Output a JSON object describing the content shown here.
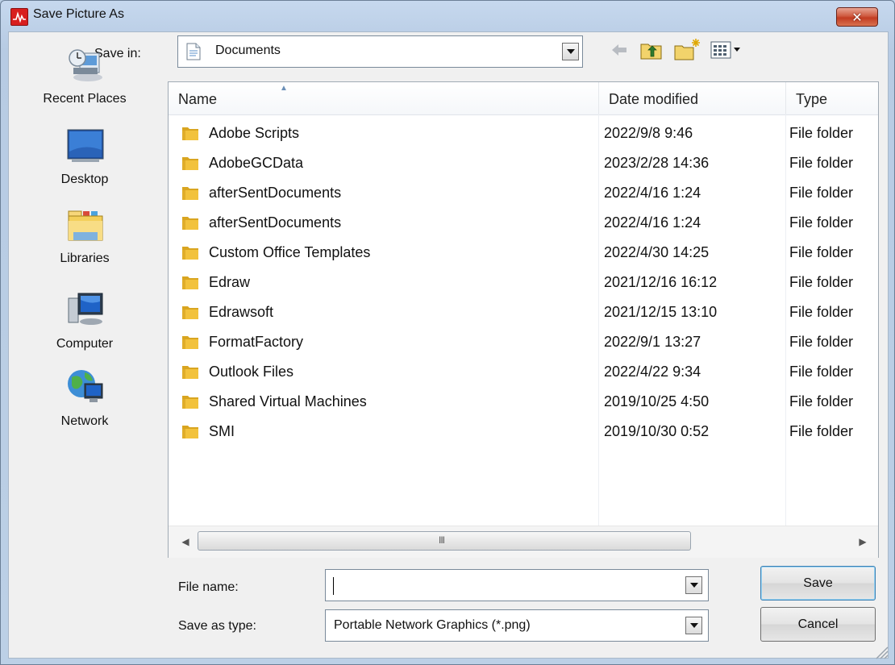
{
  "window": {
    "title": "Save Picture As",
    "close_label": "✕"
  },
  "save_in": {
    "label": "Save in:",
    "value": "Documents"
  },
  "places": [
    {
      "label": "Recent Places",
      "icon": "recent-places-icon"
    },
    {
      "label": "Desktop",
      "icon": "desktop-icon"
    },
    {
      "label": "Libraries",
      "icon": "libraries-icon"
    },
    {
      "label": "Computer",
      "icon": "computer-icon"
    },
    {
      "label": "Network",
      "icon": "network-icon"
    }
  ],
  "columns": {
    "name": "Name",
    "date": "Date modified",
    "type": "Type"
  },
  "files": [
    {
      "name": "Adobe Scripts",
      "date": "2022/9/8 9:46",
      "type": "File folder"
    },
    {
      "name": "AdobeGCData",
      "date": "2023/2/28 14:36",
      "type": "File folder"
    },
    {
      "name": "afterSentDocuments",
      "date": "2022/4/16 1:24",
      "type": "File folder"
    },
    {
      "name": "afterSentDocuments",
      "date": "2022/4/16 1:24",
      "type": "File folder"
    },
    {
      "name": "Custom Office Templates",
      "date": "2022/4/30 14:25",
      "type": "File folder"
    },
    {
      "name": "Edraw",
      "date": "2021/12/16 16:12",
      "type": "File folder"
    },
    {
      "name": "Edrawsoft",
      "date": "2021/12/15 13:10",
      "type": "File folder"
    },
    {
      "name": "FormatFactory",
      "date": "2022/9/1 13:27",
      "type": "File folder"
    },
    {
      "name": "Outlook Files",
      "date": "2022/4/22 9:34",
      "type": "File folder"
    },
    {
      "name": "Shared Virtual Machines",
      "date": "2019/10/25 4:50",
      "type": "File folder"
    },
    {
      "name": "SMI",
      "date": "2019/10/30 0:52",
      "type": "File folder"
    }
  ],
  "scroll": {
    "grip": "III"
  },
  "file_name": {
    "label": "File name:",
    "value": ""
  },
  "save_as_type": {
    "label": "Save as type:",
    "value": "Portable Network Graphics (*.png)"
  },
  "buttons": {
    "save": "Save",
    "cancel": "Cancel"
  },
  "colors": {
    "title_bg": "#bcd0e6",
    "close_red": "#c23b21",
    "folder_yellow": "#f2c23c",
    "default_button_border": "#3c7fb1"
  }
}
